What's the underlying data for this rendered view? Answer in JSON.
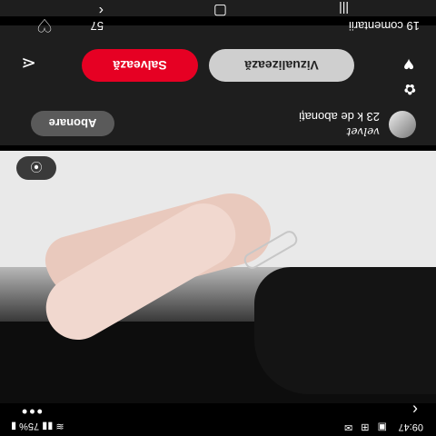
{
  "status_bar": {
    "time": "09:47",
    "battery": "75%",
    "icons": [
      "notification-icon",
      "calendar-icon",
      "wifi-icon",
      "signal-icon",
      "battery-icon"
    ]
  },
  "pin": {
    "creator_name": "velvet",
    "followers": "23 k de abonați",
    "follow_label": "Abonare",
    "visit_label": "Vizualizează",
    "save_label": "Salvează",
    "comments": "19 comentarii",
    "likes": "57"
  },
  "colors": {
    "save": "#e60023",
    "visit": "#cfcfcf",
    "follow": "#5a5a5a",
    "panel": "#1e1e1e"
  },
  "nav": {
    "icons": [
      "recent-apps-icon",
      "home-icon",
      "back-icon"
    ]
  }
}
